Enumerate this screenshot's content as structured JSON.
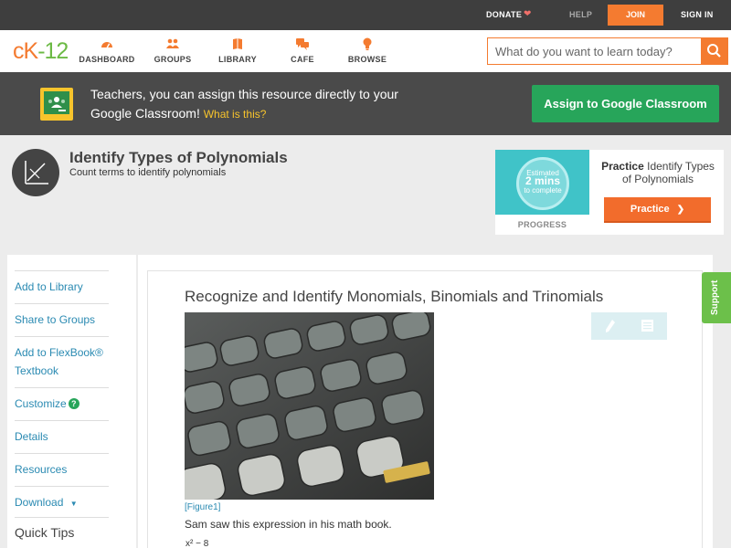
{
  "topbar": {
    "donate": "DONATE",
    "help": "HELP",
    "join": "JOIN",
    "signin": "SIGN IN"
  },
  "logo": {
    "part1": "cK",
    "part2": "-12"
  },
  "nav": [
    {
      "label": "DASHBOARD",
      "icon": "dashboard-icon"
    },
    {
      "label": "GROUPS",
      "icon": "groups-icon"
    },
    {
      "label": "LIBRARY",
      "icon": "library-icon"
    },
    {
      "label": "CAFE",
      "icon": "cafe-icon"
    },
    {
      "label": "BROWSE",
      "icon": "browse-icon"
    }
  ],
  "search": {
    "placeholder": "What do you want to learn today?"
  },
  "banner": {
    "text": "Teachers, you can assign this resource directly to your Google Classroom!",
    "what_is": "What is this?",
    "assign_button": "Assign to Google Classroom"
  },
  "concept": {
    "title": "Identify Types of Polynomials",
    "subtitle": "Count terms to identify polynomials"
  },
  "practice": {
    "estimated": "Estimated",
    "mins": "2 mins",
    "to_complete": "to complete",
    "progress_label": "PROGRESS",
    "heading_bold": "Practice",
    "heading_rest": "Identify Types of Polynomials",
    "button": "Practice"
  },
  "sidebar": {
    "items": [
      "Add to Library",
      "Share to Groups",
      "Add to FlexBook® Textbook",
      "Customize",
      "Details",
      "Resources",
      "Download"
    ],
    "quick_tips": "Quick Tips"
  },
  "lesson": {
    "title": "Recognize and Identify Monomials, Binomials and Trinomials",
    "figure_caption": "[Figure1]",
    "text": "Sam saw this expression in his math book.",
    "math_partial": "x² − 8"
  },
  "support": "Support",
  "colors": {
    "accent": "#f47b30",
    "green": "#27a55a",
    "teal": "#40c3c8",
    "link": "#2a8ab2"
  }
}
